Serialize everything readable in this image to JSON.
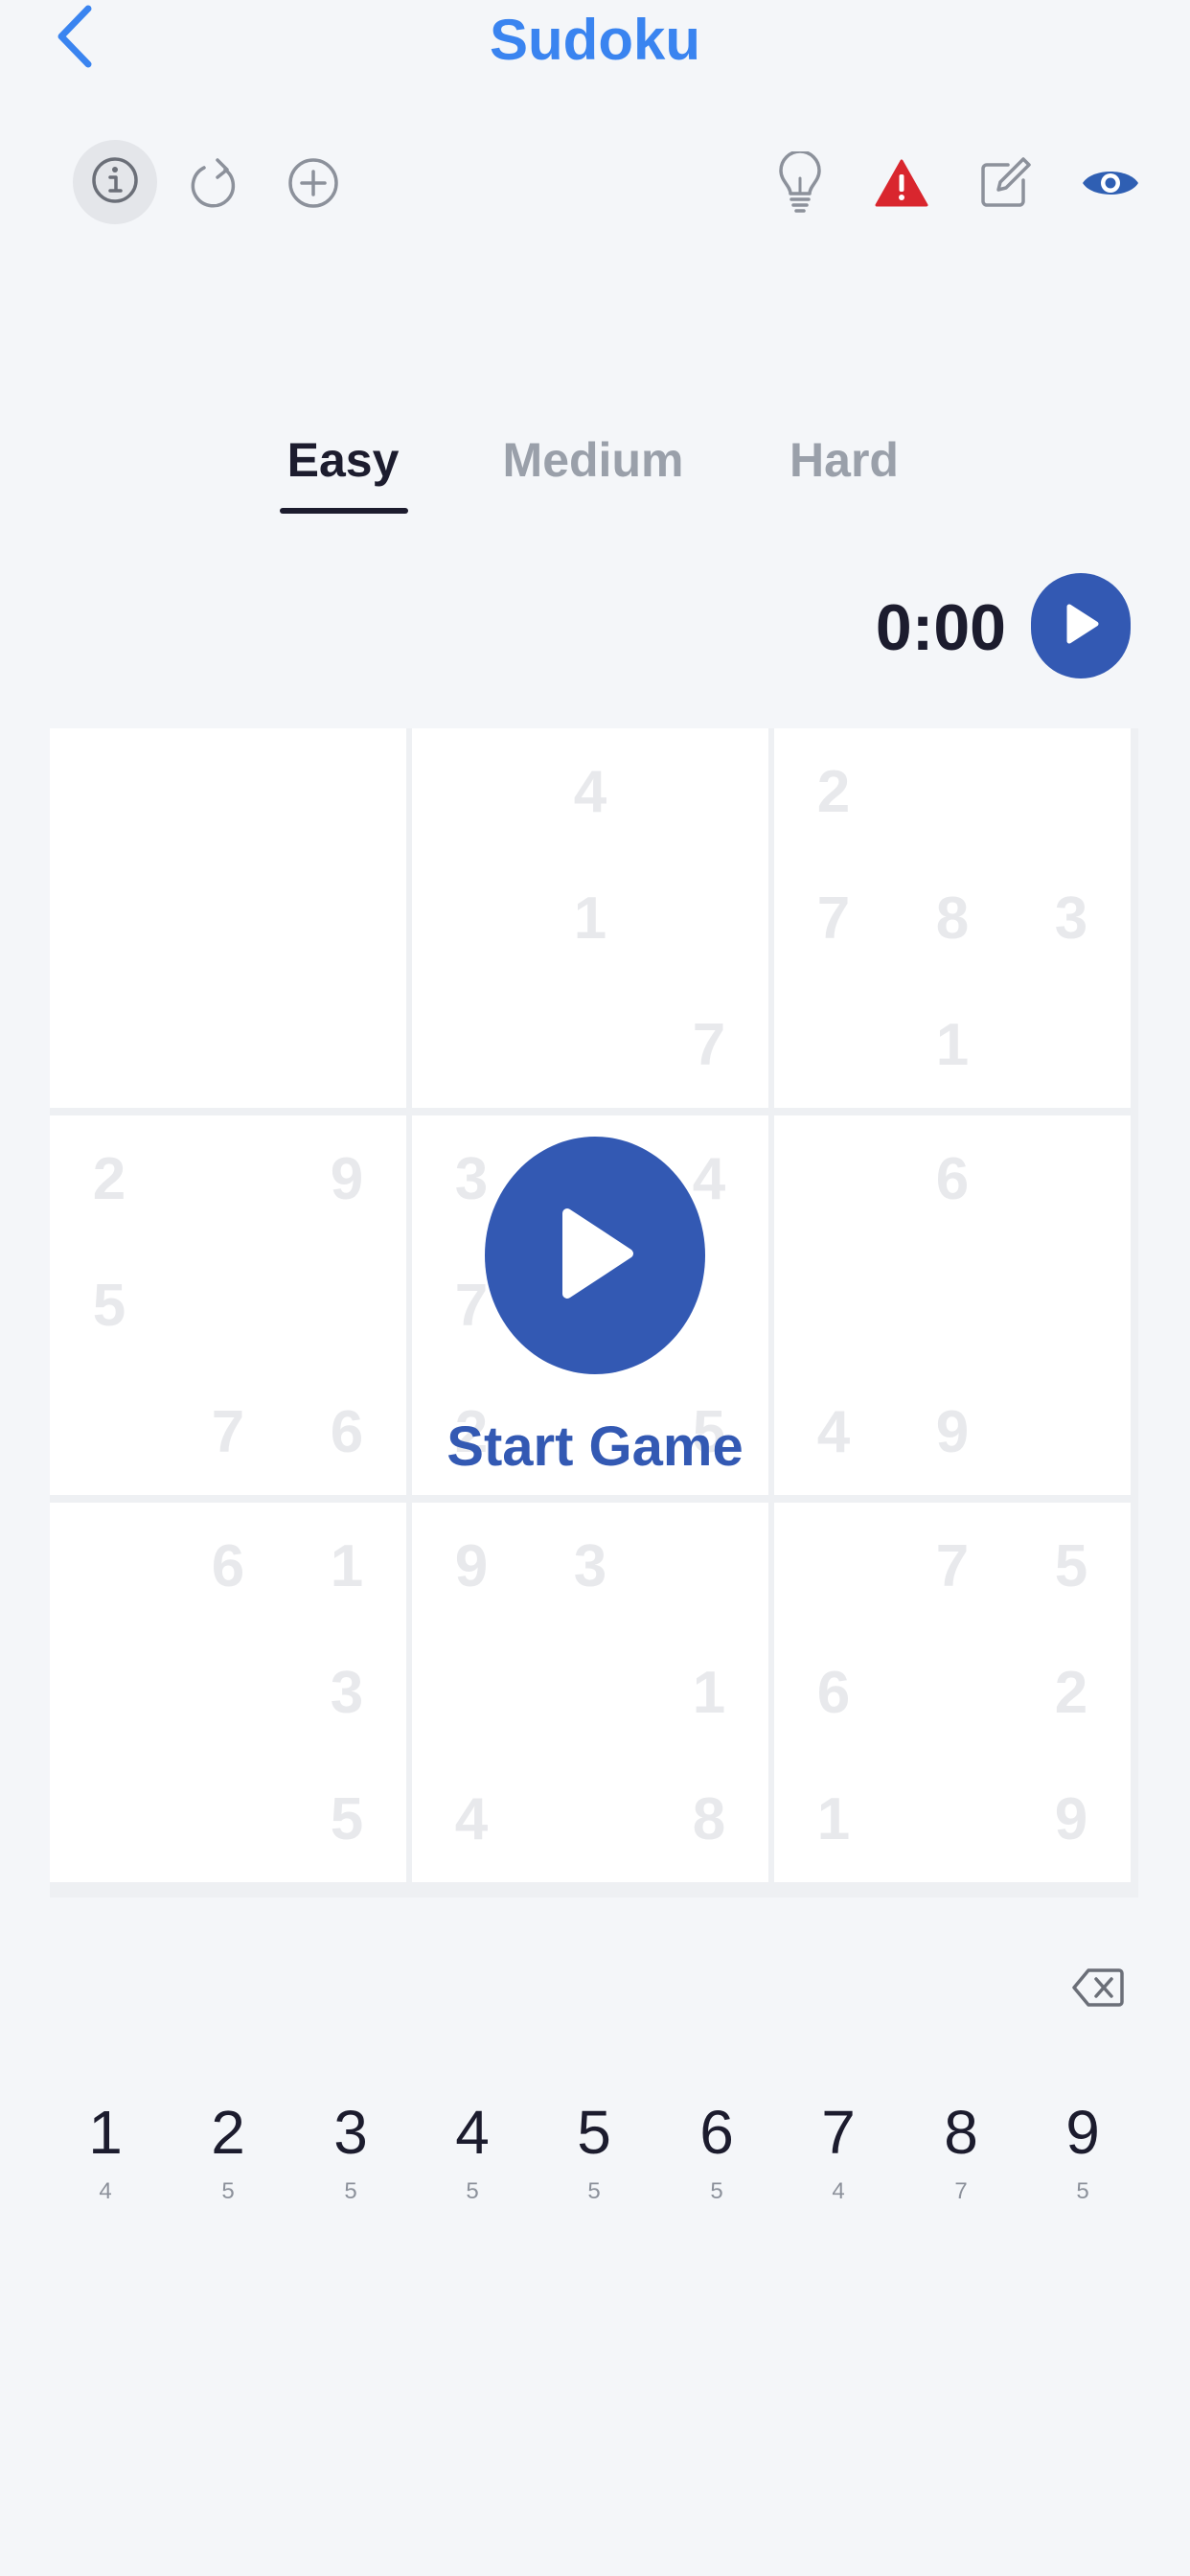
{
  "nav": {
    "title": "Sudoku"
  },
  "toolbar": {
    "icons": [
      "info-icon",
      "restart-icon",
      "add-icon",
      "hint-bulb-icon",
      "mistakes-warning-icon",
      "notes-edit-icon",
      "eye-icon"
    ],
    "accent_color": "#3a84f0",
    "warning_color": "#d9262e"
  },
  "difficulty_tabs": {
    "active": "Easy",
    "tabs": [
      {
        "label": "Easy"
      },
      {
        "label": "Medium"
      },
      {
        "label": "Hard"
      }
    ]
  },
  "timer": {
    "value": "0:00"
  },
  "board": {
    "cells": [
      [
        "",
        "",
        "",
        "",
        "4",
        "",
        "2",
        "",
        ""
      ],
      [
        "",
        "",
        "",
        "",
        "1",
        "",
        "7",
        "8",
        "3"
      ],
      [
        "",
        "",
        "",
        "",
        "",
        "7",
        "",
        "1",
        ""
      ],
      [
        "2",
        "",
        "9",
        "3",
        "",
        "4",
        "",
        "6",
        ""
      ],
      [
        "5",
        "",
        "",
        "7",
        "",
        "",
        "",
        "",
        ""
      ],
      [
        "",
        "7",
        "6",
        "2",
        "",
        "5",
        "4",
        "9",
        ""
      ],
      [
        "",
        "6",
        "1",
        "9",
        "3",
        "",
        "",
        "7",
        "5"
      ],
      [
        "",
        "",
        "3",
        "",
        "",
        "1",
        "6",
        "",
        "2"
      ],
      [
        "",
        "",
        "5",
        "4",
        "",
        "8",
        "1",
        "",
        "9"
      ]
    ]
  },
  "start_overlay": {
    "label": "Start Game",
    "color": "#3359b3"
  },
  "number_pad": {
    "keys": [
      {
        "digit": "1",
        "count": "4"
      },
      {
        "digit": "2",
        "count": "5"
      },
      {
        "digit": "3",
        "count": "5"
      },
      {
        "digit": "4",
        "count": "5"
      },
      {
        "digit": "5",
        "count": "5"
      },
      {
        "digit": "6",
        "count": "5"
      },
      {
        "digit": "7",
        "count": "4"
      },
      {
        "digit": "8",
        "count": "7"
      },
      {
        "digit": "9",
        "count": "5"
      }
    ]
  }
}
